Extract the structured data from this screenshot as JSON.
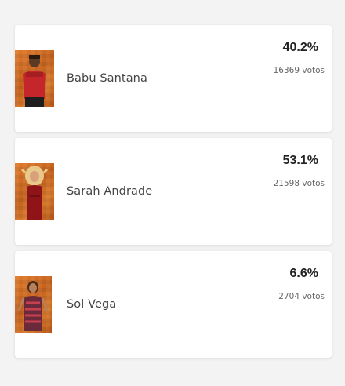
{
  "candidates": [
    {
      "name": "Babu Santana",
      "percent": "40.2%",
      "votes": "16369 votos",
      "photo_icon": "person-photo-icon"
    },
    {
      "name": "Sarah Andrade",
      "percent": "53.1%",
      "votes": "21598 votos",
      "photo_icon": "person-photo-icon"
    },
    {
      "name": "Sol Vega",
      "percent": "6.6%",
      "votes": "2704 votos",
      "photo_icon": "person-photo-icon"
    }
  ],
  "colors": {
    "background": "#f3f3f3",
    "card": "#ffffff",
    "photo_background": "#d8792a"
  }
}
